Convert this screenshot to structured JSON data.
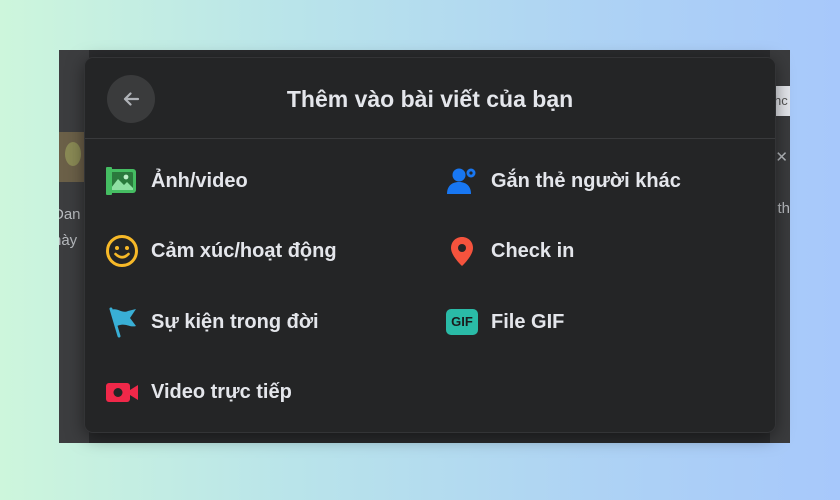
{
  "background": {
    "left_text": "Đan\nnày",
    "right_box_text": "hc",
    "right_text": "t th"
  },
  "dialog": {
    "title": "Thêm vào bài viết của bạn",
    "back_icon": "arrow-left-icon"
  },
  "options": {
    "photo_video": {
      "label": "Ảnh/video",
      "icon": "photo-icon",
      "color": "#45bd62"
    },
    "tag_people": {
      "label": "Gắn thẻ người khác",
      "icon": "tag-people-icon",
      "color": "#1877f2"
    },
    "feeling": {
      "label": "Cảm xúc/hoạt động",
      "icon": "smiley-icon",
      "color": "#f7b928"
    },
    "check_in": {
      "label": "Check in",
      "icon": "location-pin-icon",
      "color": "#f5533d"
    },
    "life_event": {
      "label": "Sự kiện trong đời",
      "icon": "flag-icon",
      "color": "#39afd5"
    },
    "gif": {
      "label": "File GIF",
      "icon": "gif-icon",
      "badge": "GIF",
      "color": "#2abba7"
    },
    "live_video": {
      "label": "Video trực tiếp",
      "icon": "live-video-icon",
      "color": "#f02849"
    }
  },
  "colors": {
    "dialog_bg": "#242526",
    "text": "#e4e6eb",
    "page_gradient_start": "#cdf6dc",
    "page_gradient_end": "#a7c8fb"
  }
}
